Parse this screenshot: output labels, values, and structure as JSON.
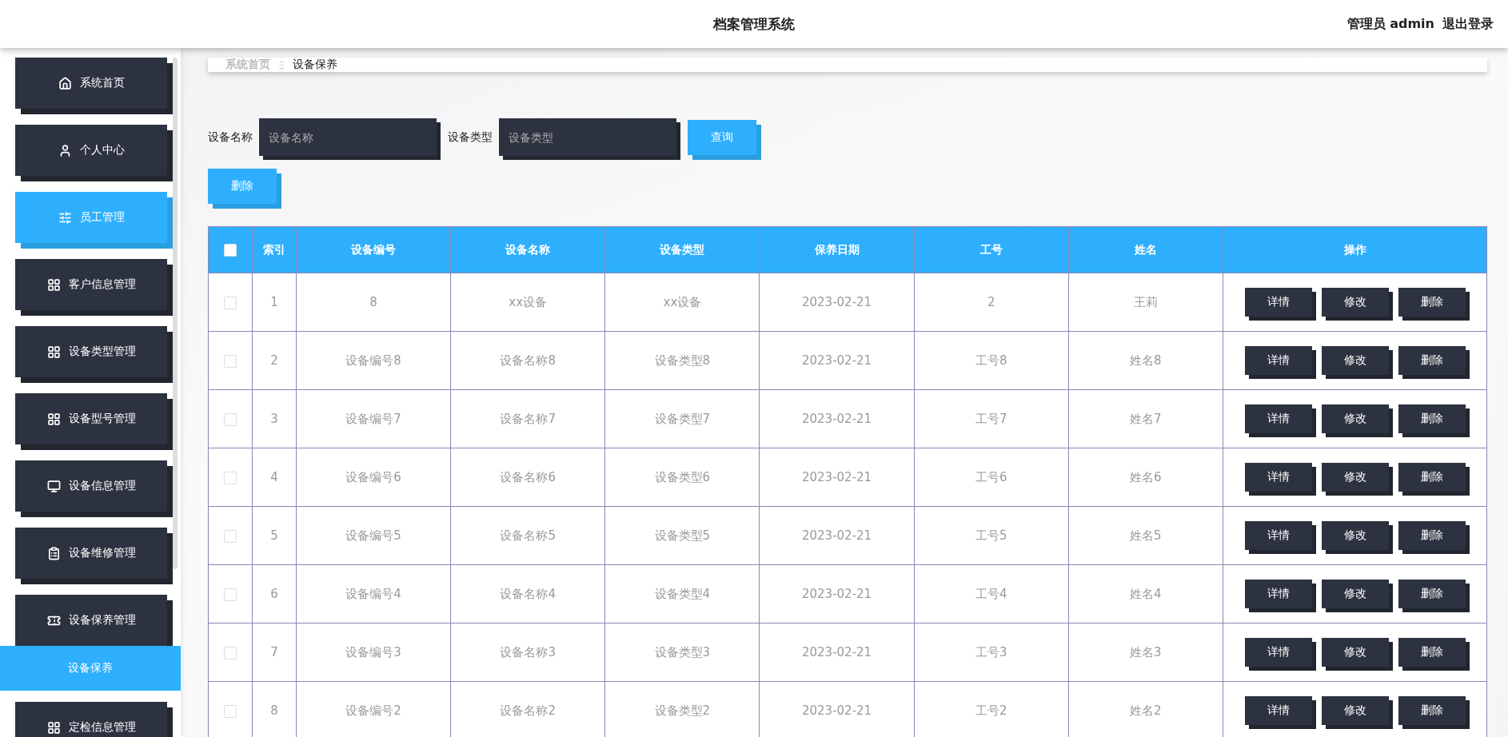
{
  "header": {
    "title": "档案管理系统",
    "user": "管理员 admin",
    "logout": "退出登录"
  },
  "sidebar": {
    "items": [
      {
        "label": "系统首页",
        "selected": false
      },
      {
        "label": "个人中心",
        "selected": false
      },
      {
        "label": "员工管理",
        "selected": true
      },
      {
        "label": "客户信息管理",
        "selected": false
      },
      {
        "label": "设备类型管理",
        "selected": false
      },
      {
        "label": "设备型号管理",
        "selected": false
      },
      {
        "label": "设备信息管理",
        "selected": false
      },
      {
        "label": "设备维修管理",
        "selected": false
      },
      {
        "label": "设备保养管理",
        "selected": false,
        "children": [
          {
            "label": "设备保养",
            "selected": true
          }
        ]
      },
      {
        "label": "定检信息管理",
        "selected": false
      }
    ]
  },
  "breadcrumb": [
    "系统首页",
    "设备保养"
  ],
  "breadcrumb_separator": "Ξ",
  "search": {
    "fields": [
      {
        "label": "设备名称",
        "placeholder": "设备名称"
      },
      {
        "label": "设备类型",
        "placeholder": "设备类型"
      }
    ],
    "button": "查询"
  },
  "delete_button": "删除",
  "table": {
    "columns": [
      "索引",
      "设备编号",
      "设备名称",
      "设备类型",
      "保养日期",
      "工号",
      "姓名",
      "操作"
    ],
    "select_all": {
      "checked": false
    },
    "rows": [
      {
        "checked": false,
        "cells": [
          "1",
          "8",
          "xx设备",
          "xx设备",
          "2023-02-21",
          "2",
          "王莉"
        ],
        "actions": [
          "详情",
          "修改",
          "删除"
        ]
      },
      {
        "checked": false,
        "cells": [
          "2",
          "设备编号8",
          "设备名称8",
          "设备类型8",
          "2023-02-21",
          "工号8",
          "姓名8"
        ],
        "actions": [
          "详情",
          "修改",
          "删除"
        ]
      },
      {
        "checked": false,
        "cells": [
          "3",
          "设备编号7",
          "设备名称7",
          "设备类型7",
          "2023-02-21",
          "工号7",
          "姓名7"
        ],
        "actions": [
          "详情",
          "修改",
          "删除"
        ]
      },
      {
        "checked": false,
        "cells": [
          "4",
          "设备编号6",
          "设备名称6",
          "设备类型6",
          "2023-02-21",
          "工号6",
          "姓名6"
        ],
        "actions": [
          "详情",
          "修改",
          "删除"
        ]
      },
      {
        "checked": false,
        "cells": [
          "5",
          "设备编号5",
          "设备名称5",
          "设备类型5",
          "2023-02-21",
          "工号5",
          "姓名5"
        ],
        "actions": [
          "详情",
          "修改",
          "删除"
        ]
      },
      {
        "checked": false,
        "cells": [
          "6",
          "设备编号4",
          "设备名称4",
          "设备类型4",
          "2023-02-21",
          "工号4",
          "姓名4"
        ],
        "actions": [
          "详情",
          "修改",
          "删除"
        ]
      },
      {
        "checked": false,
        "cells": [
          "7",
          "设备编号3",
          "设备名称3",
          "设备类型3",
          "2023-02-21",
          "工号3",
          "姓名3"
        ],
        "actions": [
          "详情",
          "修改",
          "删除"
        ]
      },
      {
        "checked": false,
        "cells": [
          "8",
          "设备编号2",
          "设备名称2",
          "设备类型2",
          "2023-02-21",
          "工号2",
          "姓名2"
        ],
        "actions": [
          "详情",
          "修改",
          "删除"
        ]
      }
    ]
  }
}
